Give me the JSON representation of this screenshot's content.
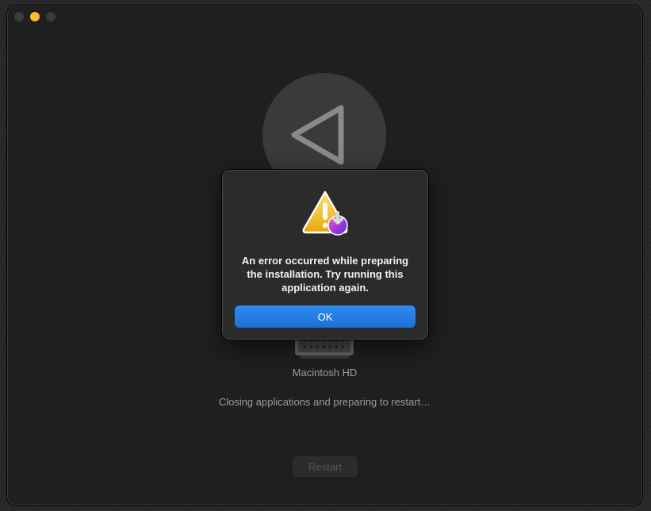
{
  "window": {
    "traffic_lights": [
      "close",
      "minimize",
      "zoom"
    ]
  },
  "installer": {
    "app_icon": "macos-installer-arrow-icon",
    "disk_icon": "hard-drive-icon",
    "disk_label": "Macintosh HD",
    "status": "Closing applications and preparing to restart…",
    "restart_label": "Restart"
  },
  "alert": {
    "icon": "warning-installer-icon",
    "message": "An error occurred while preparing the installation. Try running this application again.",
    "ok_label": "OK"
  },
  "colors": {
    "accent": "#1f6fd6",
    "warning": "#f5c518",
    "minimize": "#febc2e"
  }
}
